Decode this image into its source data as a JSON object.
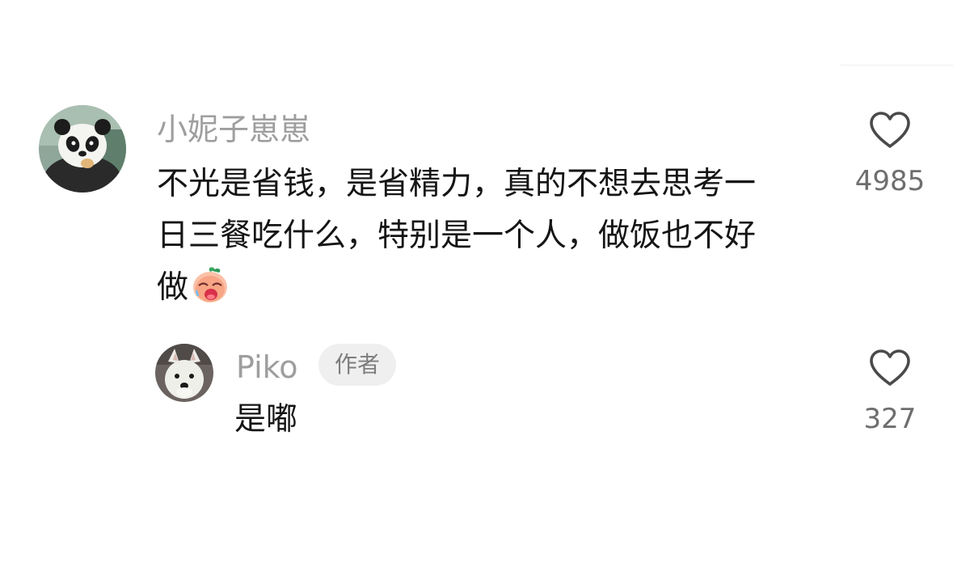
{
  "comment": {
    "username": "小妮子崽崽",
    "text_lines": [
      "不光是省钱，是省精力，真的不想去思考一",
      "日三餐吃什么，特别是一个人，做饭也不好",
      "做"
    ],
    "emoji": "sad-peach-emoji",
    "likes": "4985",
    "avatar": "panda-avatar"
  },
  "reply": {
    "username": "Piko",
    "badge": "作者",
    "text": "是嘟",
    "likes": "327",
    "avatar": "white-dog-avatar"
  },
  "icons": {
    "like": "heart-outline-icon"
  },
  "colors": {
    "username": "#9e9e9e",
    "text": "#151515",
    "count": "#6e6e6e",
    "badge_bg": "#efefef"
  }
}
